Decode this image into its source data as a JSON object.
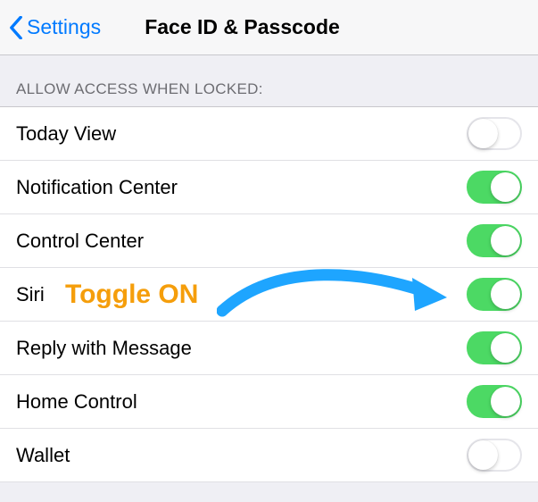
{
  "nav": {
    "back_label": "Settings",
    "title": "Face ID & Passcode"
  },
  "section_header": "ALLOW ACCESS WHEN LOCKED:",
  "rows": [
    {
      "label": "Today View",
      "on": false
    },
    {
      "label": "Notification Center",
      "on": true
    },
    {
      "label": "Control Center",
      "on": true
    },
    {
      "label": "Siri",
      "on": true
    },
    {
      "label": "Reply with Message",
      "on": true
    },
    {
      "label": "Home Control",
      "on": true
    },
    {
      "label": "Wallet",
      "on": false
    }
  ],
  "annotation": {
    "text": "Toggle ON",
    "color": "#f59e0b",
    "arrow_color": "#1ea5ff"
  }
}
